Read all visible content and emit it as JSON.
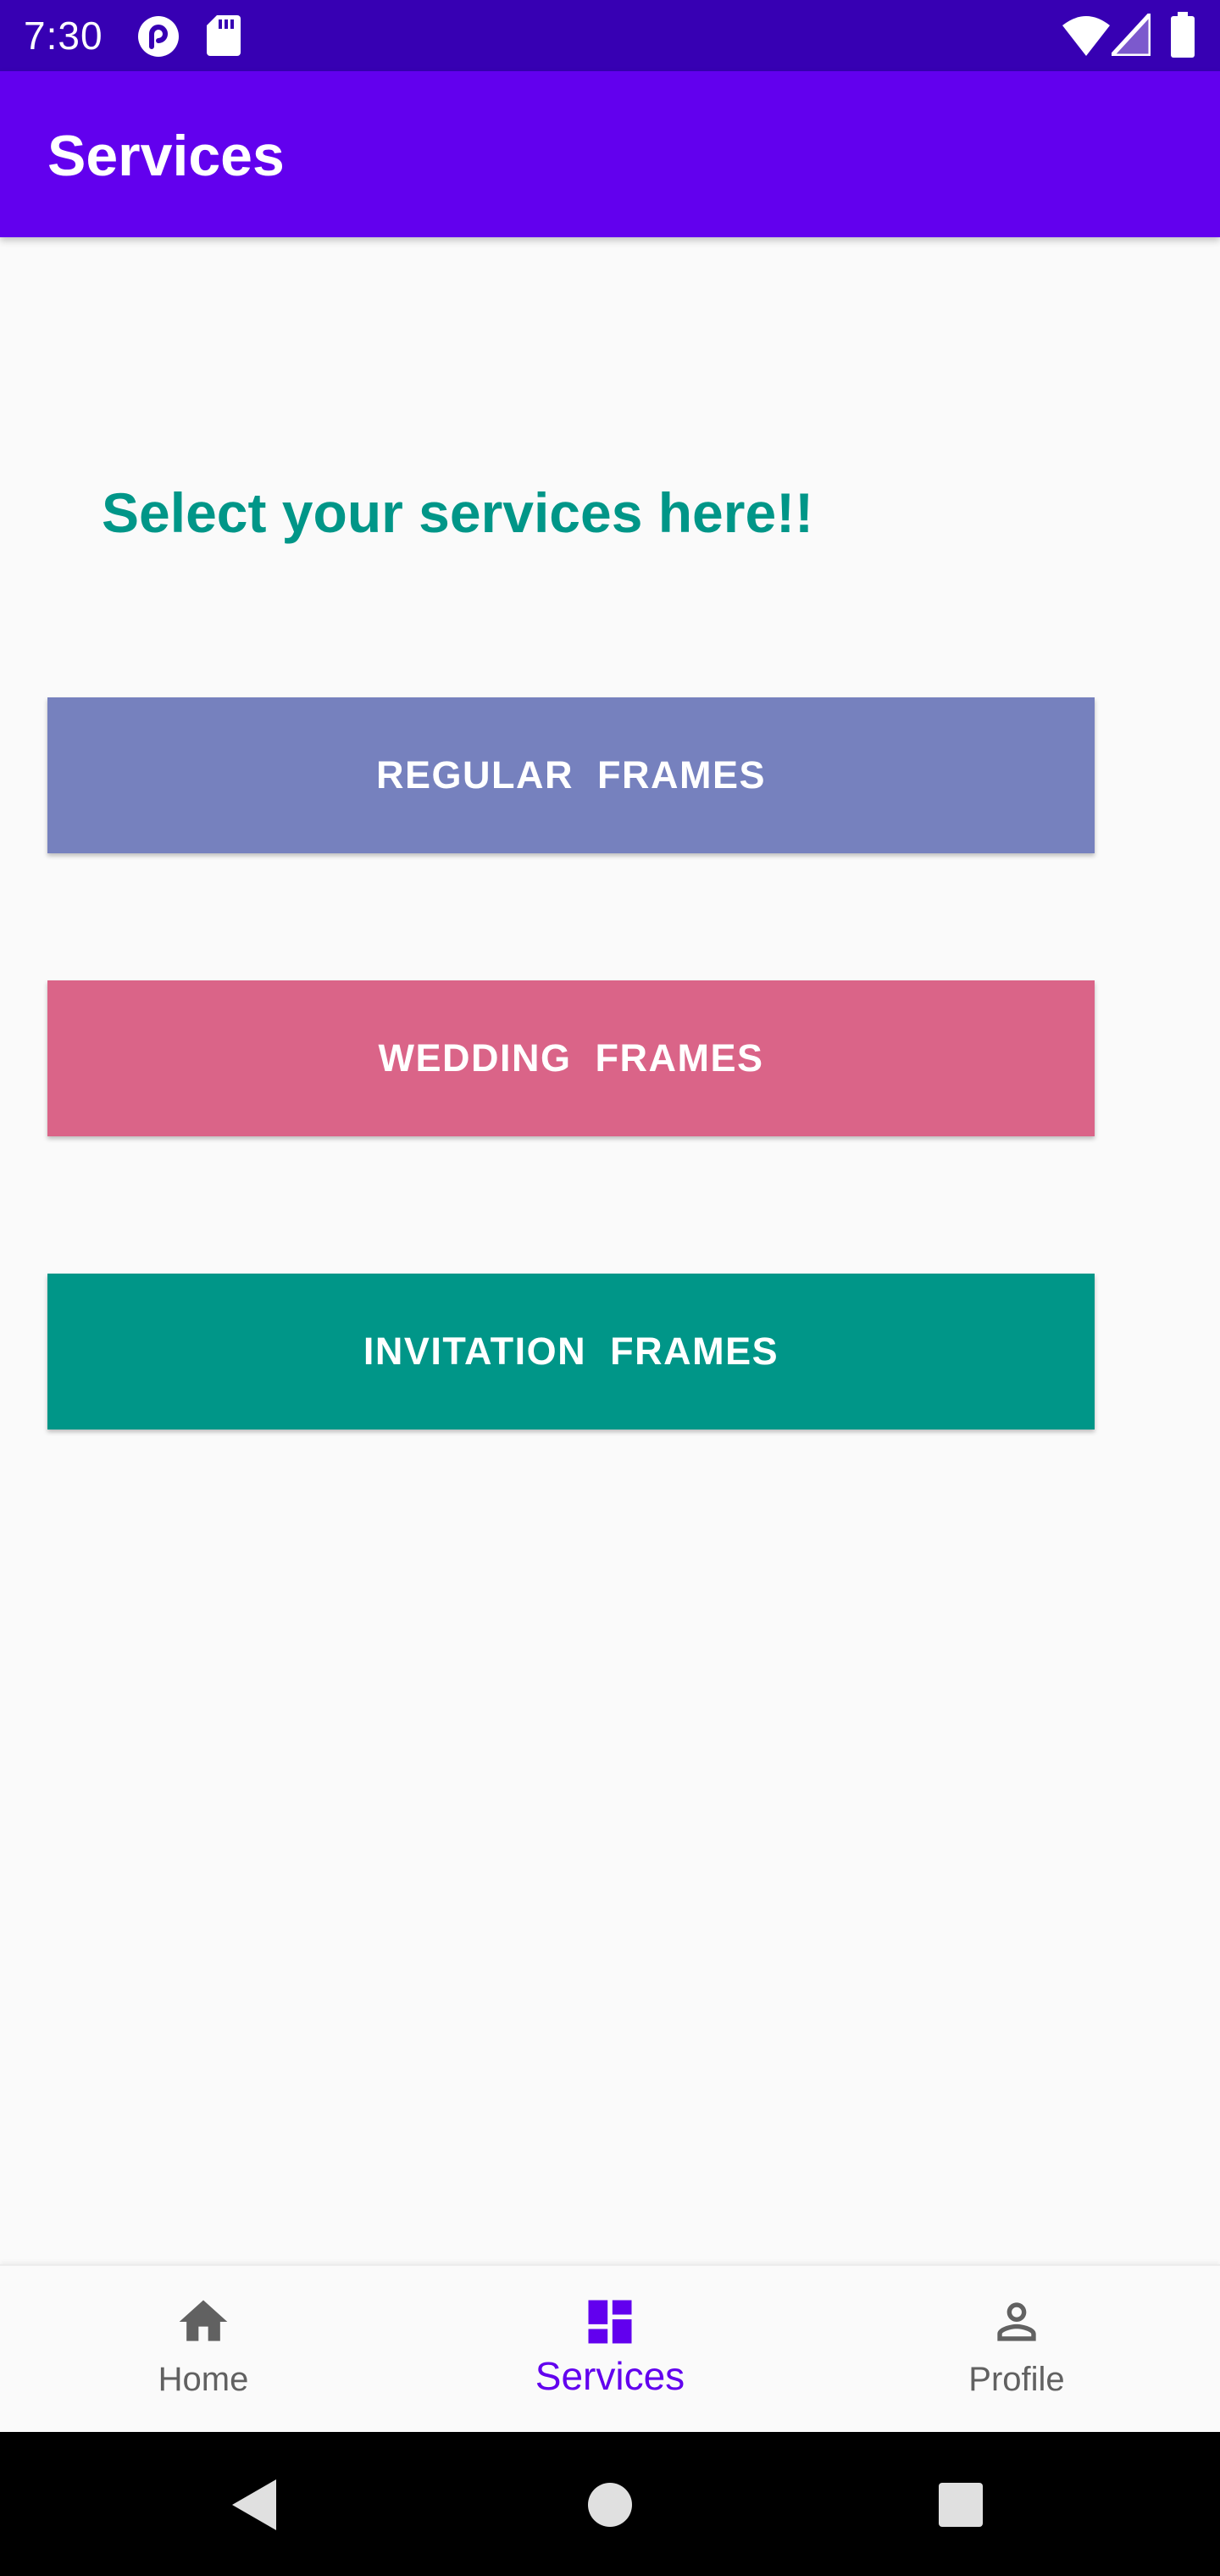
{
  "status_bar": {
    "time": "7:30",
    "icons": [
      "pocket-casts-icon",
      "sd-card-icon",
      "wifi-icon",
      "signal-icon",
      "battery-icon"
    ]
  },
  "app_bar": {
    "title": "Services",
    "color": "#6200ee"
  },
  "main": {
    "heading": "Select your services here!!",
    "buttons": [
      {
        "label": "REGULAR  FRAMES",
        "color": "#7681be"
      },
      {
        "label": "WEDDING  FRAMES",
        "color": "#da6488"
      },
      {
        "label": "INVITATION  FRAMES",
        "color": "#009688"
      }
    ]
  },
  "bottom_nav": {
    "items": [
      {
        "label": "Home",
        "icon": "home-icon",
        "selected": false
      },
      {
        "label": "Services",
        "icon": "dashboard-icon",
        "selected": true
      },
      {
        "label": "Profile",
        "icon": "person-icon",
        "selected": false
      }
    ],
    "active_color": "#6200ee",
    "inactive_color": "#616161"
  },
  "system_nav": {
    "buttons": [
      "back-icon",
      "home-circle-icon",
      "recents-icon"
    ]
  }
}
